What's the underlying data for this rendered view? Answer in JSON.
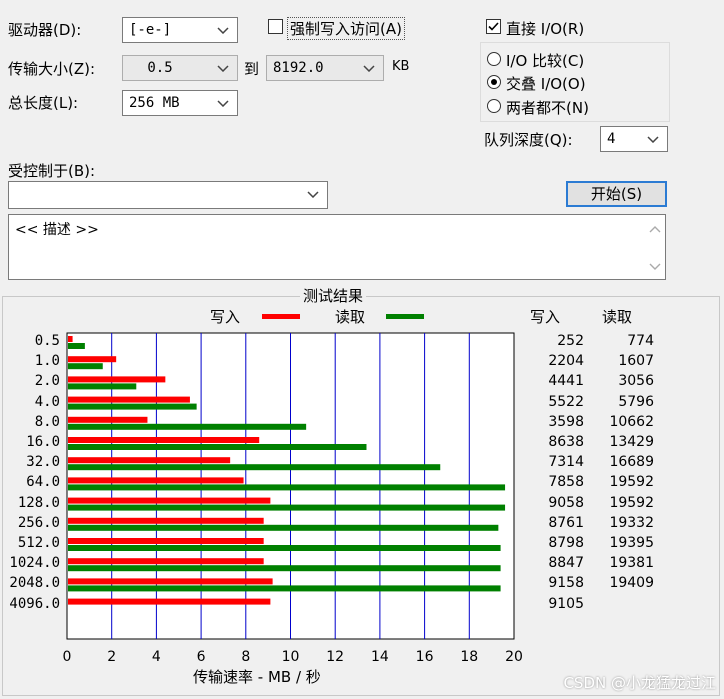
{
  "controls": {
    "drive_label": "驱动器(D):",
    "drive_value": "[-e-]",
    "force_write_label": "强制写入访问(A)",
    "direct_io_label": "直接 I/O(R)",
    "transfer_size_label": "传输大小(Z):",
    "transfer_from": "0.5",
    "to_label": "到",
    "transfer_to": "8192.0",
    "unit_kb": "KB",
    "total_length_label": "总长度(L):",
    "total_length_value": "256 MB",
    "radio_compare": "I/O 比较(C)",
    "radio_overlap": "交叠 I/O(O)",
    "radio_neither": "两者都不(N)",
    "queue_depth_label": "队列深度(Q):",
    "queue_depth_value": "4",
    "controlled_by_label": "受控制于(B):",
    "controlled_by_value": "",
    "start_button": "开始(S)",
    "description": "<< 描述 >>"
  },
  "results": {
    "title": "测试结果",
    "legend_write": "写入",
    "legend_read": "读取",
    "col_write": "写入",
    "col_read": "读取",
    "xlabel": "传输速率 - MB / 秒",
    "write_color": "#ff0000",
    "read_color": "#008000",
    "grid_color": "#0000cc"
  },
  "chart_data": {
    "type": "bar",
    "orientation": "horizontal",
    "categories": [
      "0.5",
      "1.0",
      "2.0",
      "4.0",
      "8.0",
      "16.0",
      "32.0",
      "64.0",
      "128.0",
      "256.0",
      "512.0",
      "1024.0",
      "2048.0",
      "4096.0"
    ],
    "series": [
      {
        "name": "写入",
        "values": [
          0.25,
          2.2,
          4.4,
          5.5,
          3.6,
          8.6,
          7.3,
          7.9,
          9.1,
          8.8,
          8.8,
          8.8,
          9.2,
          9.1
        ]
      },
      {
        "name": "读取",
        "values": [
          0.8,
          1.6,
          3.1,
          5.8,
          10.7,
          13.4,
          16.7,
          19.6,
          19.6,
          19.3,
          19.4,
          19.4,
          19.4,
          null
        ]
      }
    ],
    "table_write": [
      "252",
      "2204",
      "4441",
      "5522",
      "3598",
      "8638",
      "7314",
      "7858",
      "9058",
      "8761",
      "8798",
      "8847",
      "9158",
      "9105"
    ],
    "table_read": [
      "774",
      "1607",
      "3056",
      "5796",
      "10662",
      "13429",
      "16689",
      "19592",
      "19592",
      "19332",
      "19395",
      "19381",
      "19409",
      ""
    ],
    "xlim": [
      0,
      20
    ],
    "xticks": [
      "0",
      "2",
      "4",
      "6",
      "8",
      "10",
      "12",
      "14",
      "16",
      "18",
      "20"
    ],
    "grid": true
  },
  "watermark": "CSDN @小龙猛龙过江"
}
